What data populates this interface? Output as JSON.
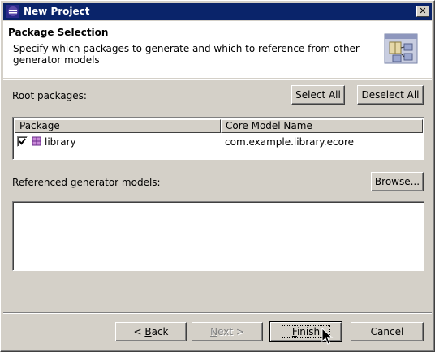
{
  "window": {
    "title": "New Project",
    "close_glyph": "✕"
  },
  "header": {
    "title": "Package Selection",
    "description": "Specify which packages to generate and which to reference from other generator models",
    "graphic_icon": "wizard-package-graphic"
  },
  "root_packages": {
    "label": "Root packages:",
    "select_all": "Select All",
    "deselect_all": "Deselect All",
    "columns": [
      "Package",
      "Core Model Name"
    ],
    "rows": [
      {
        "checked": true,
        "package": "library",
        "core_model": "com.example.library.ecore"
      }
    ]
  },
  "referenced": {
    "label": "Referenced generator models:",
    "browse": "Browse...",
    "items": []
  },
  "footer": {
    "back_prefix": "< ",
    "back_mnemonic": "B",
    "back_rest": "ack",
    "next_mnemonic": "N",
    "next_rest": "ext >",
    "finish_mnemonic": "F",
    "finish_rest": "inish",
    "cancel": "Cancel",
    "next_disabled": true,
    "default_button": "finish"
  },
  "colors": {
    "titlebar": "#0a246a",
    "face": "#d4d0c8",
    "header_bg": "#ffffff"
  }
}
